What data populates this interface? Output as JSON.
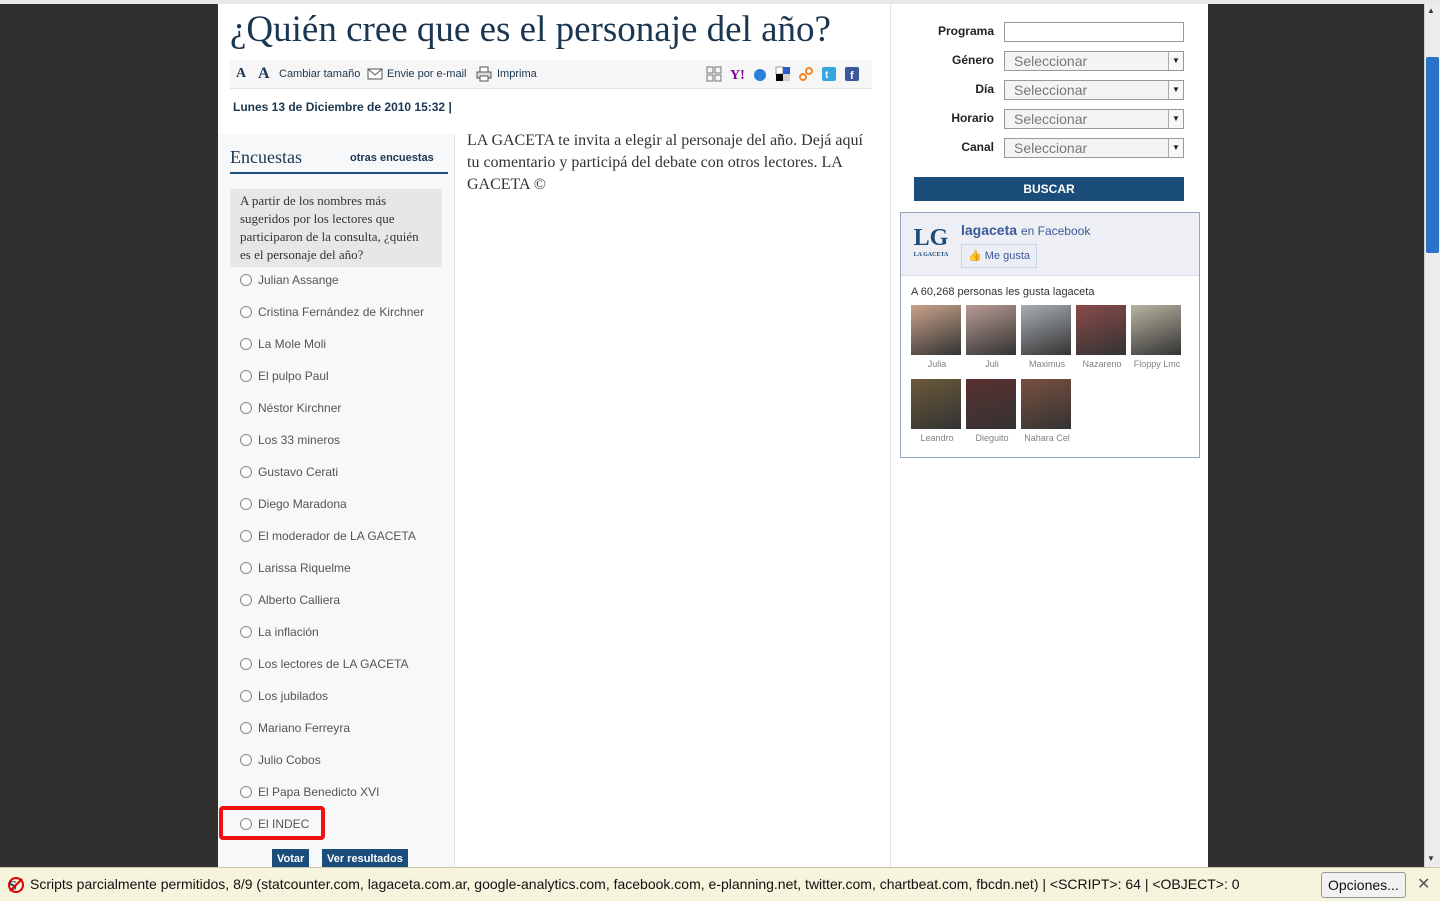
{
  "article": {
    "title": "¿Quién cree que es el personaje del año?",
    "tools": {
      "resize_label": "Cambiar tamaño",
      "email_label": "Envie por e-mail",
      "print_label": "Imprima"
    },
    "date": "Lunes 13 de Diciembre de 2010 15:32 |",
    "body": "LA GACETA te invita a elegir al personaje del año. Dejá aquí tu comentario y participá del debate con otros lectores. LA GACETA ©"
  },
  "poll": {
    "title": "Encuestas",
    "other_link": "otras encuestas",
    "question": "A partir de los nombres más sugeridos por los lectores que participaron de la consulta, ¿quién es el personaje del año?",
    "options": [
      "Julian Assange",
      "Cristina Fernández de Kirchner",
      "La Mole Moli",
      "El pulpo Paul",
      "Néstor Kirchner",
      "Los 33 mineros",
      "Gustavo Cerati",
      "Diego Maradona",
      "El moderador de LA GACETA",
      "Larissa Riquelme",
      "Alberto Calliera",
      "La inflación",
      "Los lectores de LA GACETA",
      "Los jubilados",
      "Mariano Ferreyra",
      "Julio Cobos",
      "El Papa Benedicto XVI",
      "El INDEC"
    ],
    "vote_label": "Votar",
    "results_label": "Ver resultados"
  },
  "tv_search": {
    "fields": [
      {
        "label": "Programa",
        "type": "input",
        "value": ""
      },
      {
        "label": "Género",
        "type": "select",
        "value": "Seleccionar"
      },
      {
        "label": "Día",
        "type": "select",
        "value": "Seleccionar"
      },
      {
        "label": "Horario",
        "type": "select",
        "value": "Seleccionar"
      },
      {
        "label": "Canal",
        "type": "select",
        "value": "Seleccionar"
      }
    ],
    "search_label": "BUSCAR"
  },
  "facebook": {
    "logo": "LG",
    "logo_sub": "LA GACETA",
    "page_name": "lagaceta",
    "suffix": "en Facebook",
    "like_label": "Me gusta",
    "count_text": "A 60,268 personas les gusta lagaceta",
    "fans": [
      {
        "name": "Julia",
        "color": "#c9a38a"
      },
      {
        "name": "Juli",
        "color": "#b89b93"
      },
      {
        "name": "Maximus",
        "color": "#a9aeb4"
      },
      {
        "name": "Nazareno",
        "color": "#8a4a4a"
      },
      {
        "name": "Floppy Lmc",
        "color": "#b9b4a0"
      },
      {
        "name": "Leandro",
        "color": "#6b5a3a"
      },
      {
        "name": "Dieguito",
        "color": "#5a3030"
      },
      {
        "name": "Nahara Cel",
        "color": "#7a5040"
      }
    ]
  },
  "noscript_bar": {
    "message": "Scripts parcialmente permitidos, 8/9 (statcounter.com, lagaceta.com.ar, google-analytics.com, facebook.com, e-planning.net, twitter.com, chartbeat.com, fbcdn.net) | <SCRIPT>: 64 | <OBJECT>: 0",
    "options_label": "Opciones...",
    "close_label": "✕"
  },
  "colors": {
    "brand_blue": "#1b4d7a",
    "highlight": "#ee1111",
    "fb_blue": "#3b5998"
  }
}
